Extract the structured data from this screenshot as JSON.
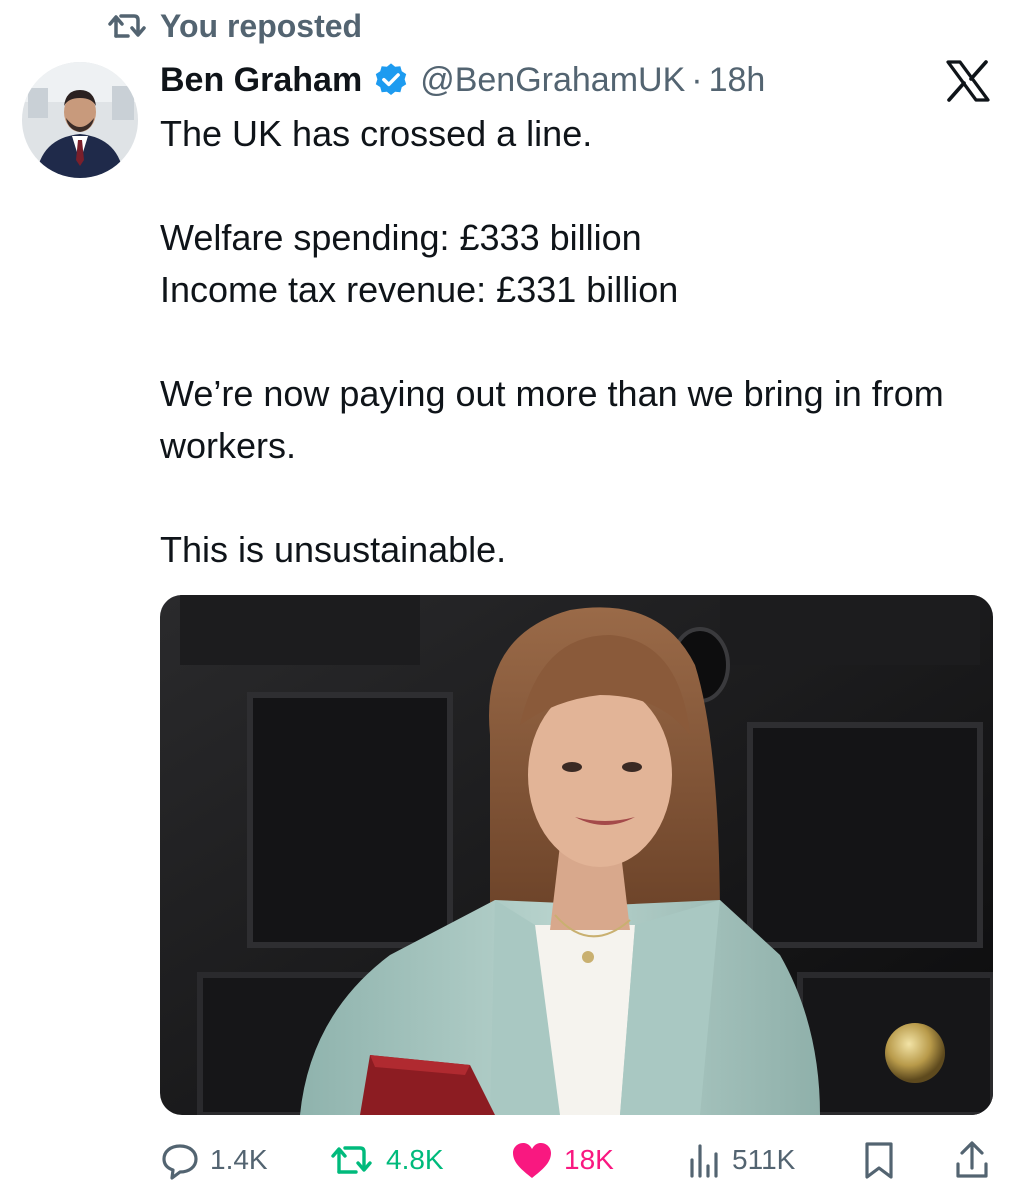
{
  "repost": {
    "text": "You reposted",
    "icon": "repost-icon"
  },
  "author": {
    "display_name": "Ben Graham",
    "handle": "@BenGrahamUK",
    "separator": "·",
    "time": "18h",
    "verified_icon": "verified-badge-icon",
    "avatar": "avatar"
  },
  "platform_logo": "x-logo-icon",
  "tweet": {
    "lines": [
      "The UK has crossed a line.",
      "Welfare spending: £333 billion",
      "Income tax revenue: £331 billion",
      "We’re now paying out more than we bring in from workers.",
      "This is unsustainable."
    ]
  },
  "actions": {
    "replies": "1.4K",
    "reposts": "4.8K",
    "likes": "18K",
    "views": "511K"
  },
  "colors": {
    "text": "#0f1419",
    "secondary": "#536471",
    "verified": "#1d9bf0",
    "repost_green": "#00ba7c",
    "like_pink": "#f91880"
  }
}
